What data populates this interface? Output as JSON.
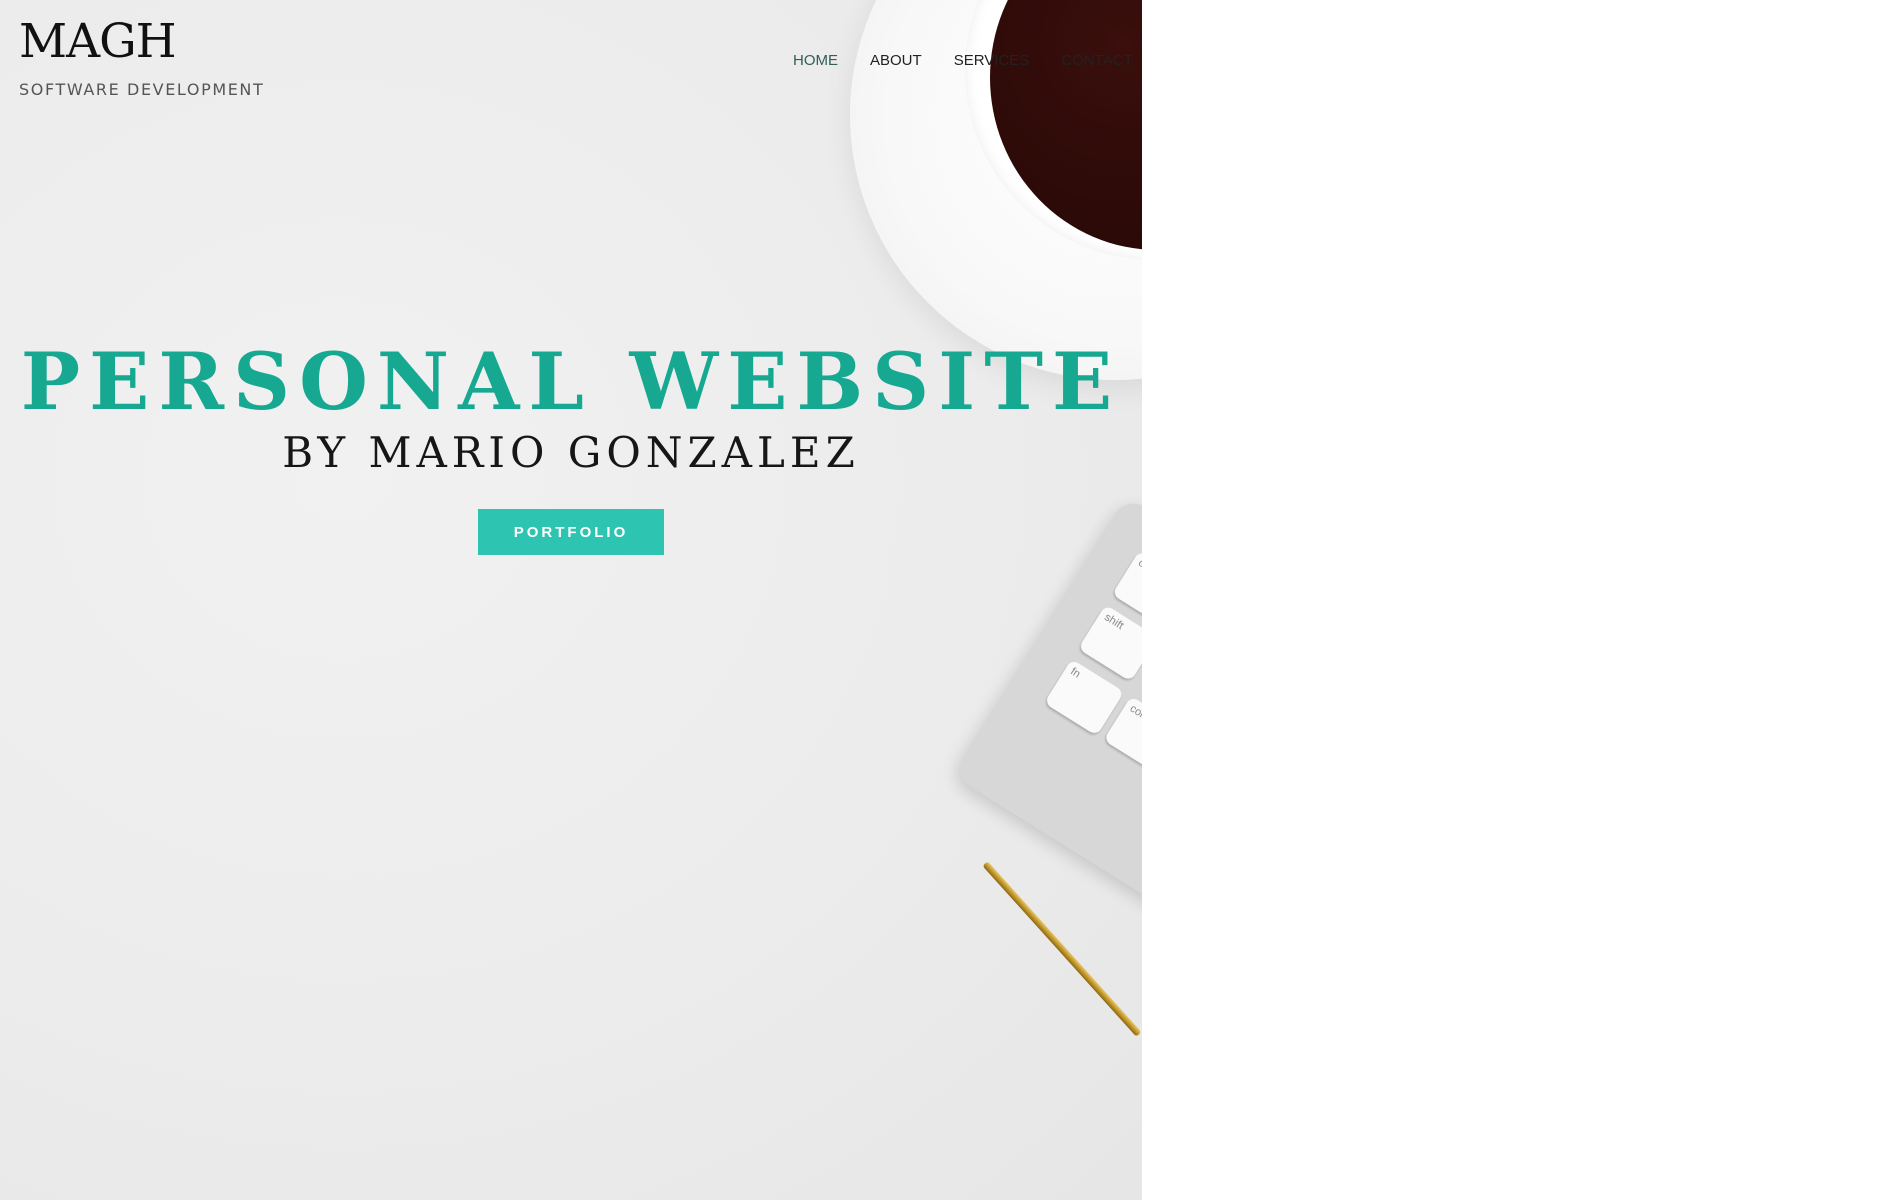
{
  "brand": {
    "title": "MAGH",
    "subtitle": "SOFTWARE DEVELOPMENT"
  },
  "nav": {
    "items": [
      {
        "label": "HOME"
      },
      {
        "label": "ABOUT"
      },
      {
        "label": "SERVICES"
      },
      {
        "label": "CONTACT"
      }
    ]
  },
  "hero": {
    "headline": "PERSONAL WEBSITE",
    "subline": "BY MARIO GONZALEZ",
    "cta_label": "PORTFOLIO"
  },
  "keyboard": {
    "keys": [
      "caps lock",
      "shift",
      "fn",
      "control"
    ]
  },
  "colors": {
    "accent": "#17a892",
    "button": "#2dc4b2",
    "text_dark": "#161616"
  }
}
